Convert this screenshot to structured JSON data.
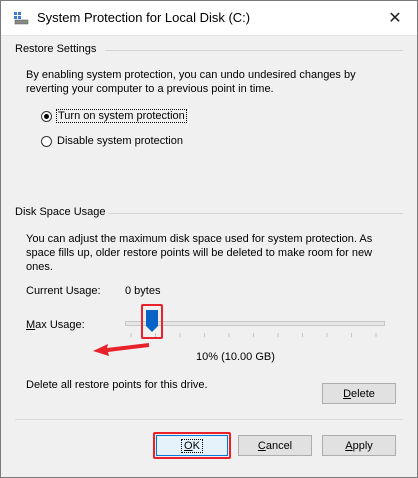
{
  "window": {
    "title": "System Protection for Local Disk (C:)",
    "close_glyph": "✕",
    "icon": "system-drive-icon"
  },
  "restore_settings": {
    "heading": "Restore Settings",
    "description_line1": "By enabling system protection, you can undo undesired changes by",
    "description_line2": "reverting your computer to a previous point in time.",
    "options": [
      {
        "label": "Turn on system protection",
        "checked": true
      },
      {
        "label": "Disable system protection",
        "checked": false
      }
    ]
  },
  "disk_space": {
    "heading": "Disk Space Usage",
    "description_line1": "You can adjust the maximum disk space used for system protection. As",
    "description_line2": "space fills up, older restore points will be deleted to make room for new",
    "description_line3": "ones.",
    "current_usage_label": "Current Usage:",
    "current_usage_value": "0 bytes",
    "max_usage_label": "Max Usage:",
    "max_usage_percent": 10,
    "max_usage_readout": "10% (10.00 GB)",
    "delete_text": "Delete all restore points for this drive.",
    "delete_button": "Delete"
  },
  "buttons": {
    "ok": "OK",
    "cancel": "Cancel",
    "apply": "Apply"
  },
  "annotation_color": "#e8212b"
}
